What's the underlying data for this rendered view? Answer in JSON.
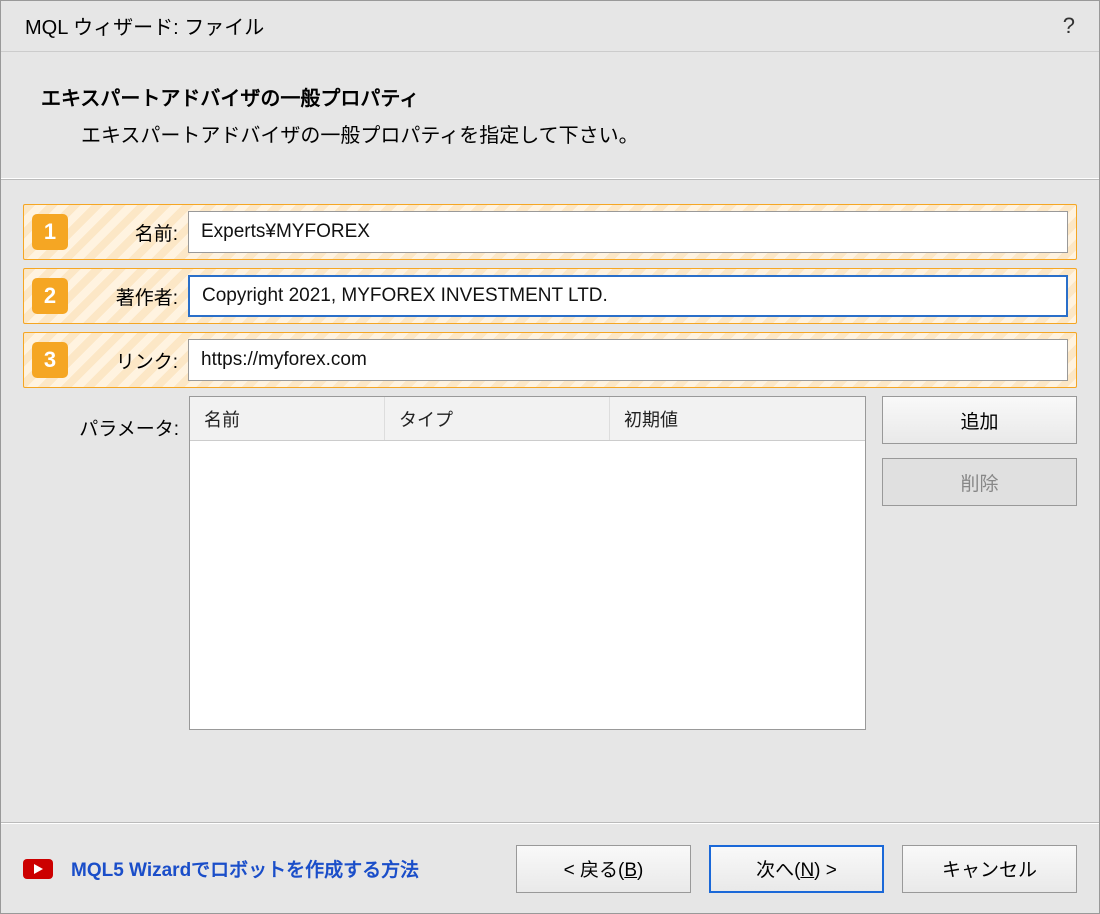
{
  "window": {
    "title": "MQL ウィザード: ファイル",
    "help": "?"
  },
  "header": {
    "title": "エキスパートアドバイザの一般プロパティ",
    "description": "エキスパートアドバイザの一般プロパティを指定して下さい。"
  },
  "badges": {
    "one": "1",
    "two": "2",
    "three": "3"
  },
  "fields": {
    "name_label": "名前:",
    "name_value": "Experts¥MYFOREX",
    "author_label": "著作者:",
    "author_value": "Copyright 2021, MYFOREX INVESTMENT LTD.",
    "link_label": "リンク:",
    "link_value": "https://myforex.com"
  },
  "params": {
    "label": "パラメータ:",
    "col_name": "名前",
    "col_type": "タイプ",
    "col_init": "初期値",
    "add_button": "追加",
    "delete_button": "削除"
  },
  "footer": {
    "link_text": "MQL5 Wizardでロボットを作成する方法",
    "back_pre": "< 戻る(",
    "back_u": "B",
    "back_post": ")",
    "next_pre": "次へ(",
    "next_u": "N",
    "next_post": ") >",
    "cancel": "キャンセル"
  }
}
